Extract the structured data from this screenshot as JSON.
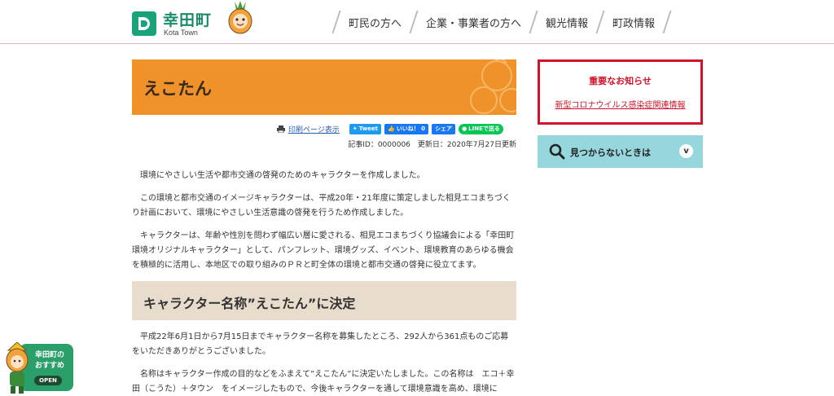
{
  "header": {
    "logo_name": "幸田町",
    "logo_sub": "Kota Town",
    "nav": [
      "町民の方へ",
      "企業・事業者の方へ",
      "観光情報",
      "町政情報"
    ]
  },
  "article": {
    "title": "えこたん",
    "print_label": "印刷ページ表示",
    "sns": {
      "tweet": "Tweet",
      "like": "いいね！ 0",
      "share": "シェア",
      "line": "LINEで送る"
    },
    "meta": "記事ID：0000006　更新日：2020年7月27日更新",
    "paragraphs": [
      "環境にやさしい生活や都市交通の啓発のためのキャラクターを作成しました。",
      "この環境と都市交通のイメージキャラクターは、平成20年・21年度に策定しました相見エコまちづくり計画において、環境にやさしい生活意識の啓発を行うため作成しました。",
      "キャラクターは、年齢や性別を問わず幅広い層に愛される、相見エコまちづくり協議会による「幸田町環境オリジナルキャラクター」として、パンフレット、環境グッズ、イベント、環境教育のあらゆる機会を積極的に活用し、本地区での取り組みのＰＲと町全体の環境と都市交通の啓発に役立てます。"
    ],
    "section_title": "キャラクター名称”えこたん”に決定",
    "section_paragraphs": [
      "平成22年6月1日から7月15日までキャラクター名称を募集したところ、292人から361点ものご応募をいただきありがとうございました。",
      "名称はキャラクター作成の目的などをふまえて”えこたん”に決定いたしました。この名称は　エコ＋幸田（こうた）＋タウン　をイメージしたもので、今後キャラクターを通して環境意識を高め、環境に"
    ]
  },
  "sidebar": {
    "notice_title": "重要なお知らせ",
    "notice_link": "新型コロナウイルス感染症関連情報",
    "faq_label": "見つからないときは",
    "faq_toggle": "v"
  },
  "recommend": {
    "line1": "幸田町の",
    "line2": "おすすめ",
    "open": "OPEN"
  },
  "colors": {
    "title_band": "#f0922a",
    "section_band": "#e8dccc",
    "notice_border": "#d0142c",
    "faq_bg": "#96d7de",
    "brand_green": "#1aa27a"
  }
}
